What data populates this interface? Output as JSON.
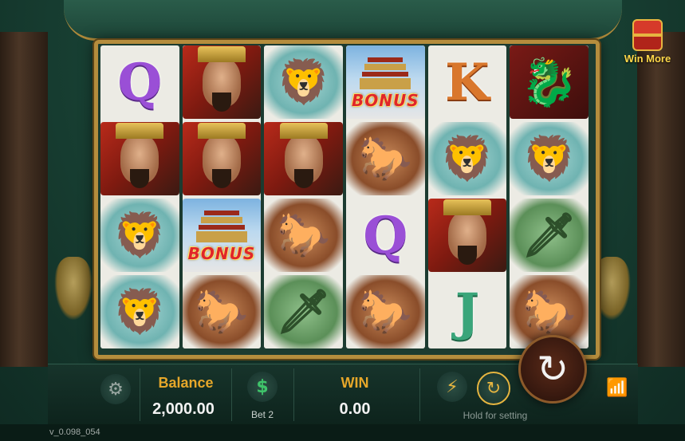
{
  "reels": [
    [
      "Q",
      "emperor",
      "lion",
      "lion"
    ],
    [
      "emperor",
      "emperor",
      "bonus",
      "horse"
    ],
    [
      "lion",
      "emperor",
      "horse",
      "warrior"
    ],
    [
      "bonus",
      "horse",
      "Q",
      "horse"
    ],
    [
      "K",
      "lion",
      "emperor",
      "J"
    ],
    [
      "dragon",
      "lion",
      "warrior",
      "horse"
    ]
  ],
  "symbol_text": {
    "Q": "Q",
    "K": "K",
    "J": "J",
    "bonus": "BONUS"
  },
  "icons": {
    "lion": "🦁",
    "horse": "🐎",
    "warrior": "🗡",
    "dragon": "🐉",
    "settings": "⚙",
    "bet": "$",
    "turbo": "⚡",
    "auto": "↻",
    "spin": "↻",
    "wifi": "📶"
  },
  "win_more": {
    "label": "Win More"
  },
  "balance": {
    "label": "Balance",
    "value": "2,000.00"
  },
  "bet": {
    "label": "Bet 2"
  },
  "win": {
    "label": "WIN",
    "value": "0.00"
  },
  "hold_hint": "Hold for setting",
  "version": "v_0.098_054"
}
